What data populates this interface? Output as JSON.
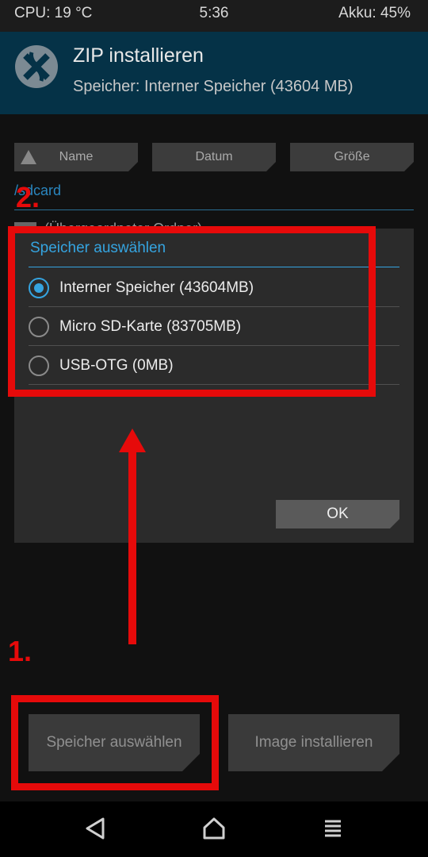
{
  "statusbar": {
    "cpu": "CPU: 19 °C",
    "time": "5:36",
    "battery": "Akku: 45%"
  },
  "header": {
    "title": "ZIP installieren",
    "subtitle": "Speicher: Interner Speicher (43604 MB)"
  },
  "sort": {
    "name": "Name",
    "date": "Datum",
    "size": "Größe"
  },
  "browser": {
    "path": "/sdcard",
    "first_item": "(Übergeordneter Ordner)"
  },
  "dialog": {
    "title": "Speicher auswählen",
    "options": [
      {
        "label": "Interner Speicher (43604MB)",
        "selected": true
      },
      {
        "label": "Micro SD-Karte (83705MB)",
        "selected": false
      },
      {
        "label": "USB-OTG (0MB)",
        "selected": false
      }
    ],
    "ok": "OK"
  },
  "buttons": {
    "select_storage": "Speicher auswählen",
    "install_image": "Image installieren"
  },
  "annotations": {
    "step1": "1.",
    "step2": "2.",
    "color": "#e60a0a"
  },
  "colors": {
    "accent": "#35a4e0",
    "header_bg": "#053247"
  },
  "icons": {
    "logo": "twrp-logo-icon",
    "back": "back-icon",
    "home": "home-icon",
    "menu": "menu-icon"
  }
}
